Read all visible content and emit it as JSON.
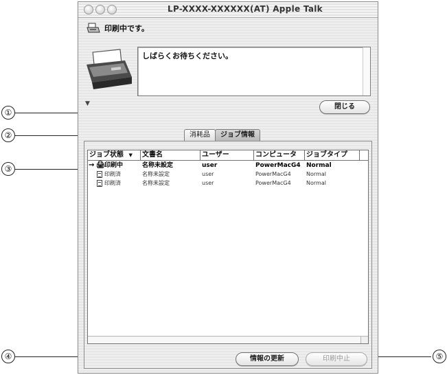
{
  "window": {
    "title": "LP-XXXX-XXXXXX(AT)  Apple Talk"
  },
  "status": {
    "text": "印刷中です。",
    "message": "しばらくお待ちください。"
  },
  "buttons": {
    "close": "閉じる",
    "refresh": "情報の更新",
    "cancel": "印刷中止"
  },
  "tabs": [
    {
      "label": "消耗品",
      "active": false
    },
    {
      "label": "ジョブ情報",
      "active": true
    }
  ],
  "table": {
    "columns": [
      "ジョブ状態",
      "文書名",
      "ユーザー",
      "コンピュータ",
      "ジョブタイプ"
    ],
    "sort_indicator": "▼",
    "rows": [
      {
        "status": "印刷中",
        "name": "名称未設定",
        "user": "user",
        "computer": "PowerMacG4",
        "type": "Normal"
      },
      {
        "status": "印刷済",
        "name": "名称未設定",
        "user": "user",
        "computer": "PowerMacG4",
        "type": "Normal"
      },
      {
        "status": "印刷済",
        "name": "名称未設定",
        "user": "user",
        "computer": "PowerMacG4",
        "type": "Normal"
      }
    ]
  },
  "callouts": [
    "①",
    "②",
    "③",
    "④",
    "⑤"
  ]
}
